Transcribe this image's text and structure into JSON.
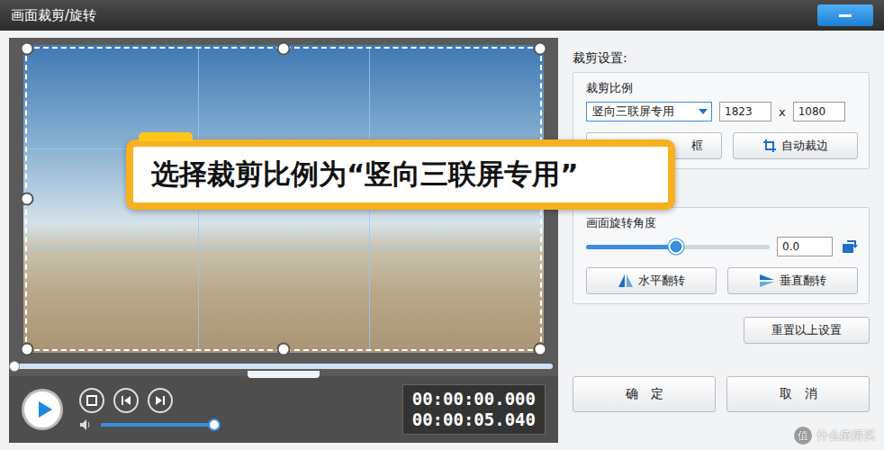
{
  "window": {
    "title": "画面裁剪/旋转"
  },
  "preview": {
    "timeline_level": 0,
    "volume_level": 1,
    "time_current": "00:00:00.000",
    "time_total": "00:00:05.040"
  },
  "callout": "选择裁剪比例为“竖向三联屏专用”",
  "crop_settings": {
    "heading": "裁剪设置:",
    "ratio_label": "裁剪比例",
    "ratio": "竖向三联屏专用",
    "width": "1823",
    "times": "x",
    "height": "1080",
    "buttons": [
      {
        "label": "框",
        "kind": "frame"
      },
      {
        "label": "自动裁边",
        "kind": "auto"
      }
    ]
  },
  "rotation": {
    "label": "画面旋转角度",
    "level": 0.49,
    "angle": "0.0",
    "flip_buttons": [
      {
        "label": "水平翻转",
        "kind": "horizontal"
      },
      {
        "label": "垂直翻转",
        "kind": "vertical"
      }
    ]
  },
  "reset": "重置以上设置",
  "dialog_buttons": [
    "确　定",
    "取　消"
  ],
  "watermark": {
    "badge": "值",
    "text": "什么值得买"
  }
}
